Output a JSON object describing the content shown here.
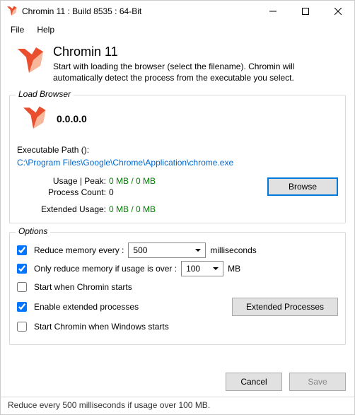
{
  "window": {
    "title": "Chromin 11 : Build 8535 : 64-Bit"
  },
  "menu": {
    "file": "File",
    "help": "Help"
  },
  "header": {
    "title": "Chromin 11",
    "desc": "Start with loading the browser (select the filename). Chromin will automatically detect the process from the executable you select."
  },
  "load": {
    "group_title": "Load Browser",
    "version": "0.0.0.0",
    "path_label": "Executable Path ():",
    "path_value": "C:\\Program Files\\Google\\Chrome\\Application\\chrome.exe",
    "usage_label": "Usage | Peak:",
    "usage_value": "0 MB / 0 MB",
    "proc_count_label": "Process Count:",
    "proc_count_value": "0",
    "ext_usage_label": "Extended Usage:",
    "ext_usage_value": "0 MB / 0 MB",
    "browse": "Browse"
  },
  "options": {
    "group_title": "Options",
    "reduce_label": "Reduce memory every :",
    "reduce_interval": "500",
    "reduce_unit": "milliseconds",
    "only_if_label": "Only reduce memory if usage is over :",
    "only_if_value": "100",
    "only_if_unit": "MB",
    "start_chromin_label": "Start  when Chromin starts",
    "enable_ext_label": "Enable extended processes",
    "ext_btn": "Extended Processes",
    "start_windows_label": "Start Chromin when Windows starts"
  },
  "buttons": {
    "cancel": "Cancel",
    "save": "Save"
  },
  "status": {
    "text": "Reduce every 500 milliseconds if usage over 100 MB."
  }
}
